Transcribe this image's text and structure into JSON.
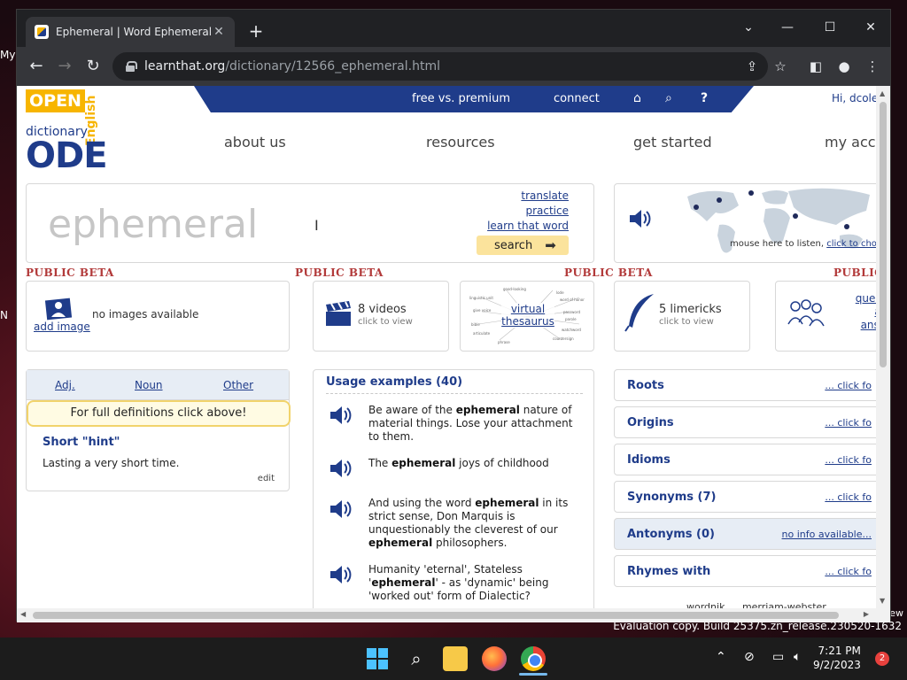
{
  "desktop": {
    "left_edge_text": "My",
    "left_edge_text2": "N",
    "right_edge_text": "ew",
    "evaluation": "Evaluation copy. Build 25375.zn_release.230520-1632"
  },
  "browser": {
    "tab_title": "Ephemeral | Word Ephemeral at",
    "url_host": "learnthat.org",
    "url_path": "/dictionary/12566_ephemeral.html"
  },
  "site": {
    "logo": {
      "open": "OPEN",
      "english": "English",
      "dictionary": "dictionary",
      "ode": "ODE"
    },
    "topnav": [
      "free vs. premium",
      "connect"
    ],
    "greeting": "Hi, dcolew",
    "mainnav": [
      "about us",
      "resources",
      "get started",
      "my acco"
    ],
    "search": {
      "word": "ephemeral",
      "links": [
        "translate",
        "practice",
        "learn that word"
      ],
      "button": "search"
    },
    "map": {
      "text": "mouse here to listen, ",
      "link": "click to choose/add"
    },
    "beta_label": "PUBLIC BETA",
    "beta_label_cut": "PUBLIC",
    "cards": {
      "images": {
        "add": "add image",
        "none": "no images available"
      },
      "videos": {
        "title": "8 videos",
        "sub": "click to view"
      },
      "thesaurus": {
        "title": "virtual thesaurus"
      },
      "limericks": {
        "title": "5 limericks",
        "sub": "click to view"
      },
      "qa": {
        "line1": "questio",
        "line2": "and",
        "line3": "answe"
      }
    },
    "definitions": {
      "tabs": [
        "Adj.",
        "Noun",
        "Other"
      ],
      "note": "For full definitions click above!",
      "hint_title": "Short \"hint\"",
      "hint": "Lasting a very short time.",
      "edit": "edit"
    },
    "usage": {
      "title": "Usage examples (40)",
      "examples": [
        {
          "pre": "Be aware of the ",
          "bold": "ephemeral",
          "post": " nature of material things. Lose your attachment to them."
        },
        {
          "pre": "The ",
          "bold": "ephemeral",
          "post": " joys of childhood"
        },
        {
          "pre": "And using the word ",
          "bold": "ephemeral",
          "post": " in its strict sense, Don Marquis is unquestionably the cleverest of our ",
          "bold2": "ephemeral",
          "post2": " philosophers."
        },
        {
          "pre": "Humanity 'eternal', Stateless '",
          "bold": "ephemeral",
          "post": "' - as 'dynamic' being 'worked out' form of Dialectic?"
        }
      ]
    },
    "right_sections": [
      {
        "label": "Roots",
        "link": "... click fo"
      },
      {
        "label": "Origins",
        "link": "... click fo"
      },
      {
        "label": "Idioms",
        "link": "... click fo"
      },
      {
        "label": "Synonyms (7)",
        "link": "... click fo"
      },
      {
        "label": "Antonyms (0)",
        "link": "no info available..."
      },
      {
        "label": "Rhymes with",
        "link": "... click fo"
      }
    ],
    "cut_links": [
      "wordnik",
      "merriam-webster"
    ]
  },
  "taskbar": {
    "time": "7:21 PM",
    "date": "9/2/2023",
    "notifications": "2"
  },
  "colors": {
    "brand_blue": "#1f3c8a",
    "brand_yellow": "#f7b500",
    "beta_red": "#b23a3a"
  }
}
